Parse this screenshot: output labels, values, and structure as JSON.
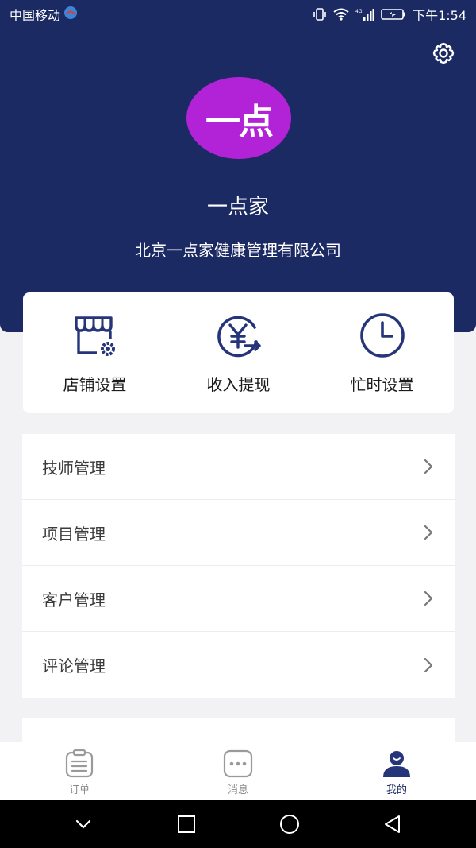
{
  "status_bar": {
    "carrier": "中国移动",
    "time": "下午1:54",
    "icons": [
      "vibrate-icon",
      "wifi-icon",
      "signal-4g-icon",
      "battery-charging-icon"
    ]
  },
  "header": {
    "background_color": "#1c2a63",
    "settings_icon": "gear-icon",
    "avatar_text": "一点",
    "avatar_color": "#b223d8",
    "shop_name": "一点家",
    "company_name": "北京一点家健康管理有限公司"
  },
  "quick_actions": [
    {
      "icon": "store-settings-icon",
      "label": "店铺设置"
    },
    {
      "icon": "yuan-withdraw-icon",
      "label": "收入提现"
    },
    {
      "icon": "clock-icon",
      "label": "忙时设置"
    }
  ],
  "menu": {
    "items": [
      {
        "label": "技师管理",
        "icon": "chevron-right-icon"
      },
      {
        "label": "项目管理",
        "icon": "chevron-right-icon"
      },
      {
        "label": "客户管理",
        "icon": "chevron-right-icon"
      },
      {
        "label": "评论管理",
        "icon": "chevron-right-icon"
      }
    ]
  },
  "tab_bar": {
    "tabs": [
      {
        "label": "订单",
        "icon": "clipboard-icon",
        "active": false
      },
      {
        "label": "消息",
        "icon": "chat-bubble-icon",
        "active": false
      },
      {
        "label": "我的",
        "icon": "user-icon",
        "active": true
      }
    ],
    "active_color": "#1c2a63",
    "inactive_color": "#8a8a8a"
  },
  "system_nav": {
    "buttons": [
      "collapse-chevron-icon",
      "recents-square-icon",
      "home-circle-icon",
      "back-triangle-icon"
    ]
  }
}
